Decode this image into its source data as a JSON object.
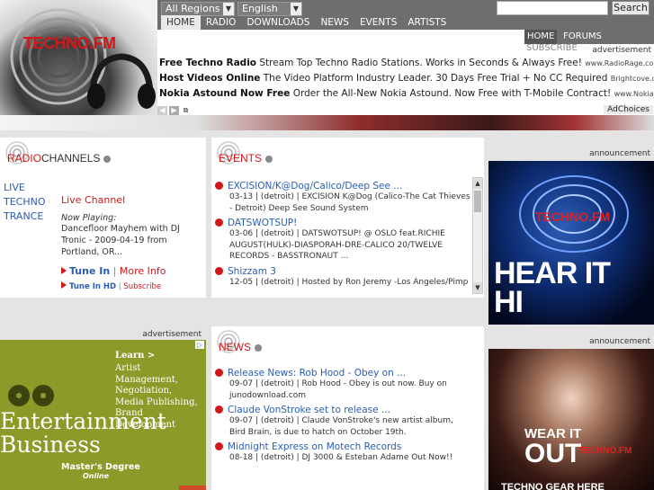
{
  "brand": {
    "logo_text": "TECHNO",
    "logo_suffix": ".FM"
  },
  "top_nav": {
    "region_select": "All Regions",
    "language_select": "English",
    "search_placeholder": "",
    "search_button": "Search",
    "items": [
      {
        "label": "HOME",
        "active": true
      },
      {
        "label": "RADIO"
      },
      {
        "label": "DOWNLOADS"
      },
      {
        "label": "NEWS"
      },
      {
        "label": "EVENTS"
      },
      {
        "label": "ARTISTS"
      }
    ]
  },
  "sub_nav": {
    "items": [
      {
        "label": "HOME",
        "active": true
      },
      {
        "label": "FORUMS"
      }
    ],
    "subscribe": "SUBSCRIBE",
    "advertisement_label": "advertisement"
  },
  "text_ads": [
    {
      "title": "Free Techno Radio",
      "body": "Stream Top Techno Radio Stations. Works in Seconds & Always Free!",
      "url": "www.RadioRage.com"
    },
    {
      "title": "Host Videos Online",
      "body": "The Video Platform Industry Leader. 30 Days Free Trial + No CC Required",
      "url": "Brightcove.com"
    },
    {
      "title": "Nokia Astound Now Free",
      "body": "Order the All-New Nokia Astound. Now Free with T-Mobile Contract!",
      "url": "www.NokiaUSA.com/A..."
    }
  ],
  "adchoices": "AdChoices",
  "radio_panel": {
    "title_red": "RADIO",
    "title_grey": "CHANNELS",
    "tabs": [
      "LIVE",
      "TECHNO",
      "TRANCE"
    ],
    "live_channel": "Live Channel",
    "now_playing_label": "Now Playing:",
    "now_playing_text": "Dancefloor Mayhem with DJ Tronic - 2009-04-19 from Portland, OR...",
    "tune_in": "Tune In",
    "separator": "|",
    "more_info": "More Info",
    "tune_in_hd": "Tune In HD",
    "subscribe": "Subscribe"
  },
  "events_panel": {
    "title": "EVENTS",
    "items": [
      {
        "headline": "EXCISION/K@Dog/Calico/Deep See ...",
        "body": "03-13 | (detroit) | EXCISION K@Dog (Calico-The Cat Thieves - Detroit) Deep See Sound System"
      },
      {
        "headline": "DATSWOTSUP!",
        "body": "03-06 | (detroit) | DATSWOTSUP! @ OSLO feat.RICHIE AUGUST(HULK)-DIASPORAH-DRE-CALICO 20/TWELVE RECORDS - BASSTRONAUT ..."
      },
      {
        "headline": "Shizzam 3",
        "body": "12-05 | (detroit) | Hosted by Ron Jeremy -Los Angeles/Pimp"
      }
    ]
  },
  "news_panel": {
    "title": "NEWS",
    "items": [
      {
        "headline": "Release News: Rob Hood - Obey on ...",
        "body": "09-07 | (detroit) | Rob Hood - Obey is out now. Buy on junodownload.com"
      },
      {
        "headline": "Claude VonStroke set to release ...",
        "body": "09-07 | (detroit) | Claude VonStroke's new artist album, Bird Brain, is due to hatch on October 19th."
      },
      {
        "headline": "Midnight Express on Motech Records",
        "body": "08-18 | (detroit) | DJ 3000 & Esteban Adame Out Now!!"
      }
    ]
  },
  "announcement_1": {
    "label": "announcement",
    "brand": "TECHNO.FM",
    "line1": "HEAR IT",
    "line2": "HI QUALITY"
  },
  "announcement_2": {
    "label": "announcement",
    "line1": "WEAR IT",
    "line2": "OUT",
    "brand": "TECHNO.FM",
    "bottom": "TECHNO GEAR HERE"
  },
  "advert_2": {
    "label": "advertisement",
    "learn": "Learn >",
    "list": [
      "Artist Management,",
      "Negotiation,",
      "Media Publishing,",
      "Brand Development"
    ],
    "headline1": "Entertainment",
    "headline2": "Business",
    "degree": "Master's Degree",
    "online": "Online"
  },
  "colors": {
    "accent_red": "#d01818",
    "link_blue": "#2a5db0",
    "nav_grey": "#6e6e6e"
  }
}
